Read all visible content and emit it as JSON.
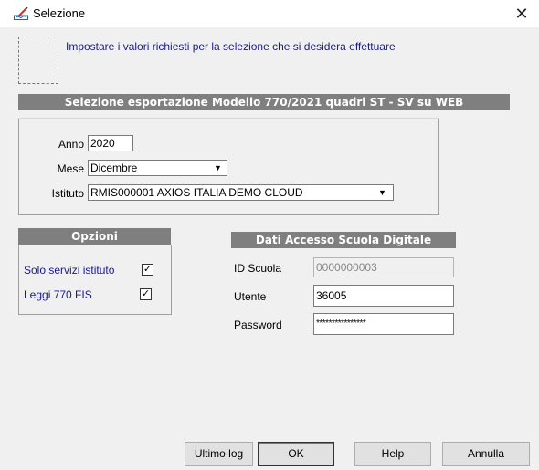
{
  "window": {
    "title": "Selezione",
    "close_glyph": "✕"
  },
  "info": {
    "text": "Impostare i valori richiesti per la selezione che si desidera effettuare"
  },
  "main_section": {
    "title": "Selezione esportazione Modello 770/2021 quadri ST - SV su WEB",
    "anno_label": "Anno",
    "anno_value": "2020",
    "mese_label": "Mese",
    "mese_value": "Dicembre",
    "istituto_label": "Istituto",
    "istituto_value": "RMIS000001 AXIOS ITALIA DEMO CLOUD"
  },
  "opzioni": {
    "title": "Opzioni",
    "items": [
      {
        "label": "Solo servizi istituto",
        "checked": true,
        "mark": "✓"
      },
      {
        "label": "Leggi 770 FIS",
        "checked": true,
        "mark": "✓"
      }
    ]
  },
  "dati_accesso": {
    "title": "Dati Accesso Scuola Digitale",
    "id_scuola_label": "ID Scuola",
    "id_scuola_value": "0000000003",
    "utente_label": "Utente",
    "utente_value": "36005",
    "password_label": "Password",
    "password_value": "****************"
  },
  "buttons": {
    "ultimo_log": "Ultimo log",
    "ok": "OK",
    "help": "Help",
    "annulla": "Annulla"
  },
  "icons": {
    "window_icon": "pen-chart-icon",
    "combo_arrow": "chevron-down-icon"
  },
  "colors": {
    "section_bar": "#7f7f7f",
    "info_text": "#1a1a8c",
    "window_bg": "#f0f0f0"
  }
}
